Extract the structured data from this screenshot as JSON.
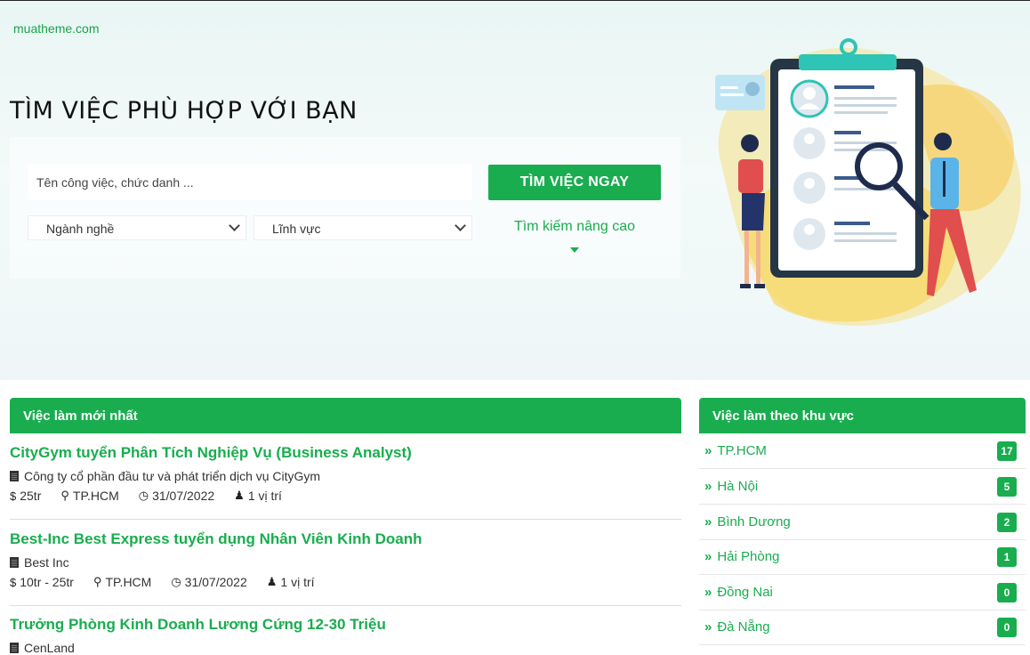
{
  "site": {
    "logo": "muatheme.com"
  },
  "hero": {
    "title": "TÌM VIỆC PHÙ HỢP VỚI BẠN",
    "search_placeholder": "Tên công việc, chức danh ...",
    "industry_select": "Ngành nghề",
    "field_select": "Lĩnh vực",
    "search_button": "TÌM VIỆC NGAY",
    "advanced_link": "Tìm kiếm nâng cao"
  },
  "latest_jobs": {
    "heading": "Việc làm mới nhất",
    "items": [
      {
        "title": "CityGym tuyển Phân Tích Nghiệp Vụ (Business Analyst)",
        "company": "Công ty cổ phần đầu tư và phát triển dịch vụ CityGym",
        "salary": "25tr",
        "location": "TP.HCM",
        "deadline": "31/07/2022",
        "positions": "1 vị trí"
      },
      {
        "title": "Best-Inc Best Express tuyển dụng Nhân Viên Kinh Doanh",
        "company": "Best Inc",
        "salary": "10tr - 25tr",
        "location": "TP.HCM",
        "deadline": "31/07/2022",
        "positions": "1 vị trí"
      },
      {
        "title": "Trưởng Phòng Kinh Doanh Lương Cứng 12-30 Triệu",
        "company": "CenLand"
      }
    ]
  },
  "regions": {
    "heading": "Việc làm theo khu vực",
    "items": [
      {
        "name": "TP.HCM",
        "count": "17"
      },
      {
        "name": "Hà Nội",
        "count": "5"
      },
      {
        "name": "Bình Dương",
        "count": "2"
      },
      {
        "name": "Hải Phòng",
        "count": "1"
      },
      {
        "name": "Đồng Nai",
        "count": "0"
      },
      {
        "name": "Đà Nẵng",
        "count": "0"
      }
    ]
  },
  "icons": {
    "salary": "dollar-icon",
    "location": "map-marker-icon",
    "deadline": "clock-icon",
    "positions": "user-icon",
    "company": "building-icon",
    "region": "double-chevron-right-icon"
  },
  "colors": {
    "accent": "#19ad4f"
  }
}
